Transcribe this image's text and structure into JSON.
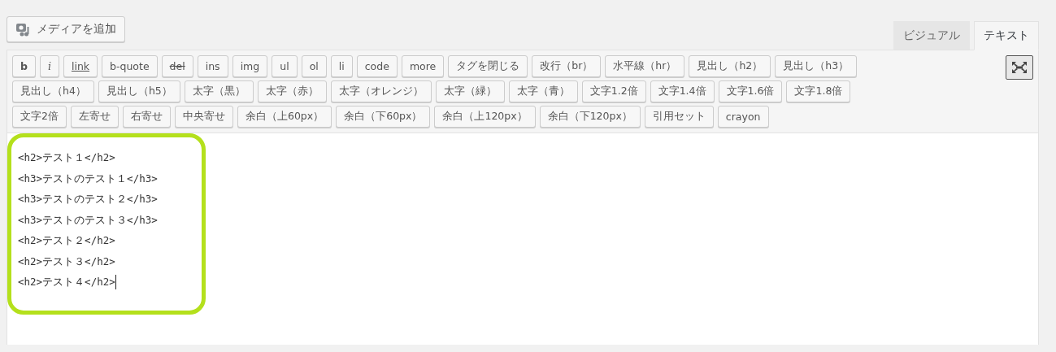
{
  "media_button": {
    "label": "メディアを追加"
  },
  "tabs": [
    {
      "label": "ビジュアル",
      "selected": false
    },
    {
      "label": "テキスト",
      "selected": true
    }
  ],
  "toolbar_rows": [
    [
      {
        "label": "b",
        "kind": "bold"
      },
      {
        "label": "i",
        "kind": "italic"
      },
      {
        "label": "link",
        "kind": "underline"
      },
      {
        "label": "b-quote",
        "kind": "plain"
      },
      {
        "label": "del",
        "kind": "strike"
      },
      {
        "label": "ins",
        "kind": "plain"
      },
      {
        "label": "img",
        "kind": "plain"
      },
      {
        "label": "ul",
        "kind": "plain"
      },
      {
        "label": "ol",
        "kind": "plain"
      },
      {
        "label": "li",
        "kind": "plain"
      },
      {
        "label": "code",
        "kind": "plain"
      },
      {
        "label": "more",
        "kind": "plain"
      },
      {
        "label": "タグを閉じる",
        "kind": "plain"
      },
      {
        "label": "改行（br）",
        "kind": "plain"
      },
      {
        "label": "水平線（hr）",
        "kind": "plain"
      },
      {
        "label": "見出し（h2）",
        "kind": "plain"
      },
      {
        "label": "見出し（h3）",
        "kind": "plain"
      }
    ],
    [
      {
        "label": "見出し（h4）",
        "kind": "plain"
      },
      {
        "label": "見出し（h5）",
        "kind": "plain"
      },
      {
        "label": "太字（黒）",
        "kind": "plain"
      },
      {
        "label": "太字（赤）",
        "kind": "plain"
      },
      {
        "label": "太字（オレンジ）",
        "kind": "plain"
      },
      {
        "label": "太字（緑）",
        "kind": "plain"
      },
      {
        "label": "太字（青）",
        "kind": "plain"
      },
      {
        "label": "文字1.2倍",
        "kind": "plain"
      },
      {
        "label": "文字1.4倍",
        "kind": "plain"
      },
      {
        "label": "文字1.6倍",
        "kind": "plain"
      },
      {
        "label": "文字1.8倍",
        "kind": "plain"
      }
    ],
    [
      {
        "label": "文字2倍",
        "kind": "plain"
      },
      {
        "label": "左寄せ",
        "kind": "plain"
      },
      {
        "label": "右寄せ",
        "kind": "plain"
      },
      {
        "label": "中央寄せ",
        "kind": "plain"
      },
      {
        "label": "余白（上60px）",
        "kind": "plain"
      },
      {
        "label": "余白（下60px）",
        "kind": "plain"
      },
      {
        "label": "余白（上120px）",
        "kind": "plain"
      },
      {
        "label": "余白（下120px）",
        "kind": "plain"
      },
      {
        "label": "引用セット",
        "kind": "plain"
      },
      {
        "label": "crayon",
        "kind": "plain"
      }
    ]
  ],
  "editor": {
    "lines": [
      "<h2>テスト１</h2>",
      "<h3>テストのテスト１</h3>",
      "<h3>テストのテスト２</h3>",
      "<h3>テストのテスト３</h3>",
      "<h2>テスト２</h2>",
      "<h2>テスト３</h2>",
      "<h2>テスト４</h2>"
    ]
  }
}
